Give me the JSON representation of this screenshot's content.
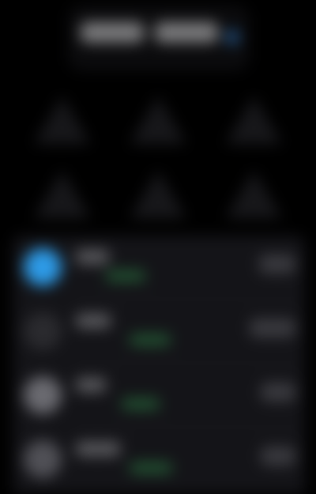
{
  "header": {
    "left_bar": "",
    "right_bar": "",
    "indicator_icon": "dot-icon"
  },
  "grid": {
    "tiles": [
      {
        "icon": "triangle-icon"
      },
      {
        "icon": "triangle-icon"
      },
      {
        "icon": "triangle-icon"
      },
      {
        "icon": "triangle-icon"
      },
      {
        "icon": "triangle-icon"
      },
      {
        "icon": "triangle-icon"
      }
    ]
  },
  "list": {
    "rows": [
      {
        "icon": "circle-icon",
        "state": "active"
      },
      {
        "icon": "circle-icon",
        "state": "dim"
      },
      {
        "icon": "circle-icon",
        "state": "grey"
      },
      {
        "icon": "circle-icon",
        "state": "grey"
      }
    ]
  },
  "colors": {
    "background": "#000000",
    "panel": "#141418",
    "accent_blue": "#2d9ae6",
    "accent_green": "#2f8a4a"
  }
}
